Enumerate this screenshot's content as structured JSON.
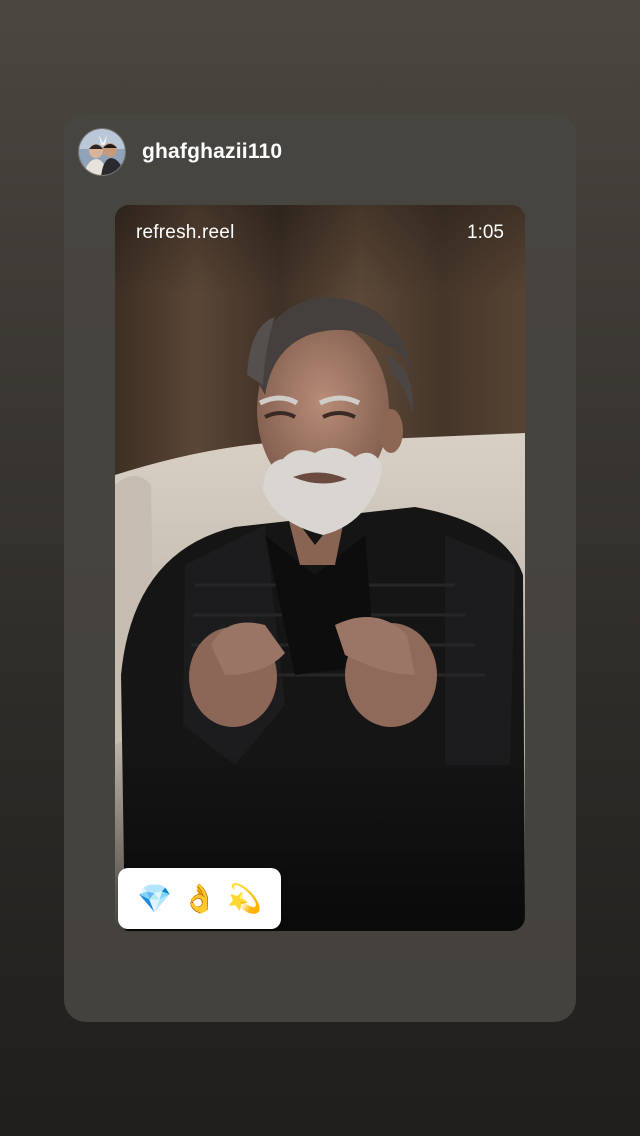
{
  "story": {
    "username": "ghafghazii110",
    "reel": {
      "account": "refresh.reel",
      "duration": "1:05"
    },
    "sticker": {
      "emojis": [
        "💎",
        "👌",
        "💫"
      ]
    }
  },
  "colors": {
    "background_top": "#4a4640",
    "background_bottom": "#1f1e1c",
    "card": "#484540",
    "sticker": "#ffffff",
    "text": "#ffffff"
  }
}
